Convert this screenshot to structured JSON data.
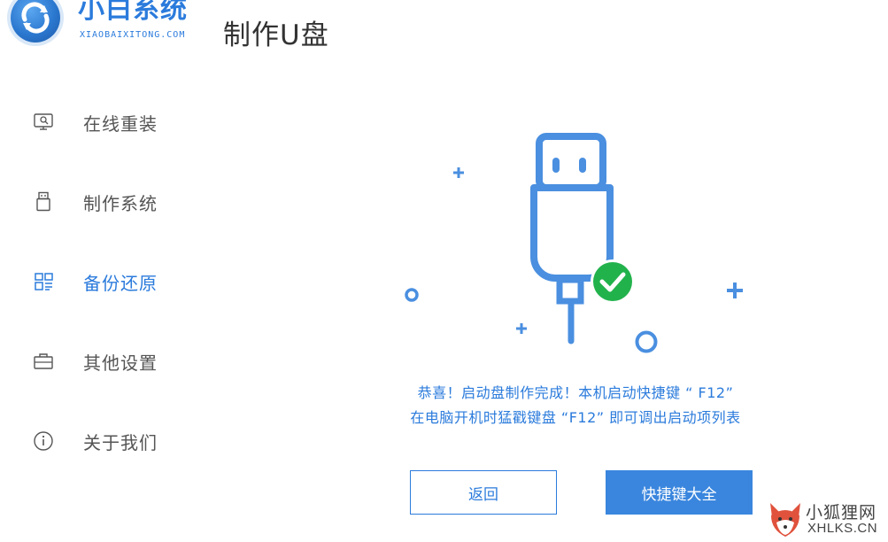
{
  "header": {
    "brand_name": "小白系统",
    "brand_sub": "XIAOBAIXITONG.COM",
    "page_title": "制作U盘"
  },
  "sidebar": {
    "items": [
      {
        "label": "在线重装",
        "icon": "monitor-icon",
        "active": false
      },
      {
        "label": "制作系统",
        "icon": "usb-drive-icon",
        "active": false
      },
      {
        "label": "备份还原",
        "icon": "grid-icon",
        "active": true
      },
      {
        "label": "其他设置",
        "icon": "briefcase-icon",
        "active": false
      },
      {
        "label": "关于我们",
        "icon": "info-icon",
        "active": false
      }
    ]
  },
  "main": {
    "message_line1": "恭喜！启动盘制作完成！本机启动快捷键 “ F12”",
    "message_line2": "在电脑开机时猛戳键盘 “F12” 即可调出启动项列表",
    "back_button": "返回",
    "shortcut_button": "快捷键大全"
  },
  "watermark": {
    "cn": "小狐狸网",
    "en": "XHLKS.CN"
  },
  "colors": {
    "accent": "#2b7bdc",
    "success": "#22b24c",
    "button_fill": "#3a86de"
  }
}
